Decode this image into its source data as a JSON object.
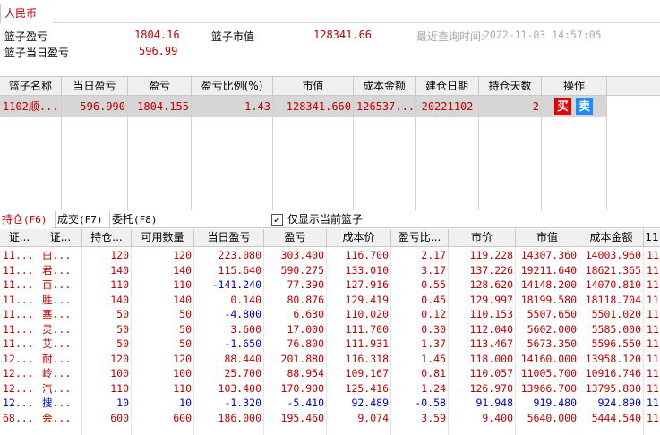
{
  "currency_tab": "人民币",
  "summary": {
    "pnl_label": "篮子盈亏",
    "pnl_value": "1804.16",
    "mv_label": "篮子市值",
    "mv_value": "128341.66",
    "today_label": "篮子当日盈亏",
    "today_value": "596.99",
    "last_query_label": "最近查询时间:",
    "last_query_time": "2022-11-03  14:57:05"
  },
  "basket": {
    "headers": [
      "篮子名称",
      "当日盈亏",
      "盈亏",
      "盈亏比例(%)",
      "市值",
      "成本金额",
      "建仓日期",
      "持仓天数",
      "操作"
    ],
    "row": {
      "name": "1102顺...",
      "today_pnl": "596.990",
      "pnl": "1804.155",
      "pnl_ratio": "1.43",
      "market_value": "128341.660",
      "cost": "126537...",
      "open_date": "20221102",
      "days": "2",
      "buy_label": "买",
      "sell_label": "卖"
    }
  },
  "tabs": [
    {
      "label": "持仓",
      "key": "(F6)"
    },
    {
      "label": "成交",
      "key": "(F7)"
    },
    {
      "label": "委托",
      "key": "(F8)"
    }
  ],
  "only_current_label": "仅显示当前篮子",
  "positions": {
    "headers": [
      "证...",
      "证...",
      "持仓...",
      "可用数量",
      "当日盈亏",
      "盈亏",
      "成本价",
      "盈亏比...",
      "市价",
      "市值",
      "成本金额",
      "11"
    ],
    "rows": [
      [
        "11...",
        "白...",
        "120",
        "120",
        "223.080",
        "303.400",
        "116.700",
        "2.17",
        "119.228",
        "14307.360",
        "14003.960",
        "11"
      ],
      [
        "11...",
        "君...",
        "140",
        "140",
        "115.640",
        "590.275",
        "133.010",
        "3.17",
        "137.226",
        "19211.640",
        "18621.365",
        "11"
      ],
      [
        "11...",
        "百...",
        "110",
        "110",
        "-141.240",
        "77.390",
        "127.916",
        "0.55",
        "128.620",
        "14148.200",
        "14070.810",
        "11"
      ],
      [
        "11...",
        "胜...",
        "140",
        "140",
        "0.140",
        "80.876",
        "129.419",
        "0.45",
        "129.997",
        "18199.580",
        "18118.704",
        "11"
      ],
      [
        "11...",
        "塞...",
        "50",
        "50",
        "-4.800",
        "6.630",
        "110.020",
        "0.12",
        "110.153",
        "5507.650",
        "5501.020",
        "11"
      ],
      [
        "11...",
        "灵...",
        "50",
        "50",
        "3.600",
        "17.000",
        "111.700",
        "0.30",
        "112.040",
        "5602.000",
        "5585.000",
        "11"
      ],
      [
        "11...",
        "艾...",
        "50",
        "50",
        "-1.650",
        "76.800",
        "111.931",
        "1.37",
        "113.467",
        "5673.350",
        "5596.550",
        "11"
      ],
      [
        "12...",
        "耐...",
        "120",
        "120",
        "88.440",
        "201.880",
        "116.318",
        "1.45",
        "118.000",
        "14160.000",
        "13958.120",
        "11"
      ],
      [
        "12...",
        "岭...",
        "100",
        "100",
        "25.700",
        "88.954",
        "109.167",
        "0.81",
        "110.057",
        "11005.700",
        "10916.746",
        "11"
      ],
      [
        "12...",
        "汽...",
        "110",
        "110",
        "103.400",
        "170.900",
        "125.416",
        "1.24",
        "126.970",
        "13966.700",
        "13795.800",
        "11"
      ],
      [
        "12...",
        "搜...",
        "10",
        "10",
        "-1.320",
        "-5.410",
        "92.489",
        "-0.58",
        "91.948",
        "919.480",
        "924.890",
        "11"
      ],
      [
        "68...",
        "会...",
        "600",
        "600",
        "186.000",
        "195.460",
        "9.074",
        "3.59",
        "9.400",
        "5640.000",
        "5444.540",
        "11"
      ]
    ]
  },
  "colors": {
    "up": "#c00000",
    "down": "#0000c8",
    "buy": "#e60000",
    "sell": "#1a8cff"
  }
}
